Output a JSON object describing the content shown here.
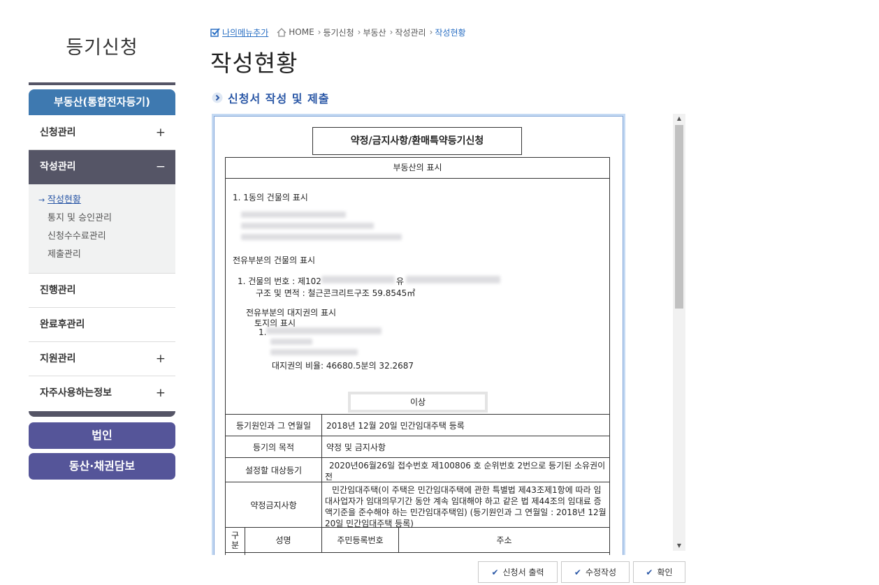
{
  "sidebar": {
    "title": "등기신청",
    "main_button": "부동산(통합전자등기)",
    "items": [
      {
        "label": "신청관리",
        "toggle": "+"
      },
      {
        "label": "작성관리",
        "toggle": "−"
      },
      {
        "label": "진행관리",
        "toggle": ""
      },
      {
        "label": "완료후관리",
        "toggle": ""
      },
      {
        "label": "지원관리",
        "toggle": "+"
      },
      {
        "label": "자주사용하는정보",
        "toggle": "+"
      }
    ],
    "submenu": [
      {
        "label": "작성현황"
      },
      {
        "label": "통지 및 승인관리"
      },
      {
        "label": "신청수수료관리"
      },
      {
        "label": "제출관리"
      }
    ],
    "bottom_buttons": [
      "법인",
      "동산·채권담보"
    ]
  },
  "header": {
    "my_menu": "나의메뉴추가",
    "breadcrumb": [
      "HOME",
      "등기신청",
      "부동산",
      "작성관리",
      "작성현황"
    ],
    "page_title": "작성현황",
    "section_title": "신청서 작성 및 제출"
  },
  "document": {
    "title": "약정/금지사항/환매특약등기신청",
    "property_header": "부동산의 표시",
    "line_building": "1. 1동의 건물의 표시",
    "line_exclusive": "전유부분의 건물의 표시",
    "line_bldg_no_prefix": "1. 건물의 번호 : 제102",
    "line_bldg_no_suffix": "유",
    "line_structure": "구조 및 면적 : 철근콘크리트구조 59.8545㎡",
    "line_land_right": "전유부분의 대지권의 표시",
    "line_land": "토지의 표시",
    "line_land_no": "1.",
    "line_ratio": "대지권의 비율: 46680.5분의 32.2687",
    "end_mark": "이상",
    "rows": [
      {
        "label": "등기원인과 그 연월일",
        "value": "2018년 12월 20일   민간임대주택 등록"
      },
      {
        "label": "등기의 목적",
        "value": "약정 및 금지사항"
      },
      {
        "label": "설정할 대상등기",
        "value": "2020년06월26일 접수번호 제100806 호 순위번호 2번으로 등기된 소유권이전"
      },
      {
        "label": "약정금지사항",
        "value": "민간임대주택(이 주택은 민간임대주택에 관한 특별법 제43조제1항에 따라 임대사업자가 임대의무기간 동안 계속 임대해야 하고 같은 법 제44조의 임대료 증액기준을 준수해야 하는 민간임대주택임) (등기원인과 그 연월일 : 2018년 12월 20일 민간임대주택 등록)"
      }
    ],
    "grid_headers": [
      "구분",
      "성명",
      "주민등록번호",
      "주소"
    ]
  },
  "buttons": {
    "print": "신청서 출력",
    "edit": "수정작성",
    "confirm": "확인"
  },
  "colors": {
    "accent_blue": "#3e79b0",
    "sidebar_dark": "#555566",
    "button_purple": "#555599",
    "link_blue": "#2a6fc3"
  }
}
